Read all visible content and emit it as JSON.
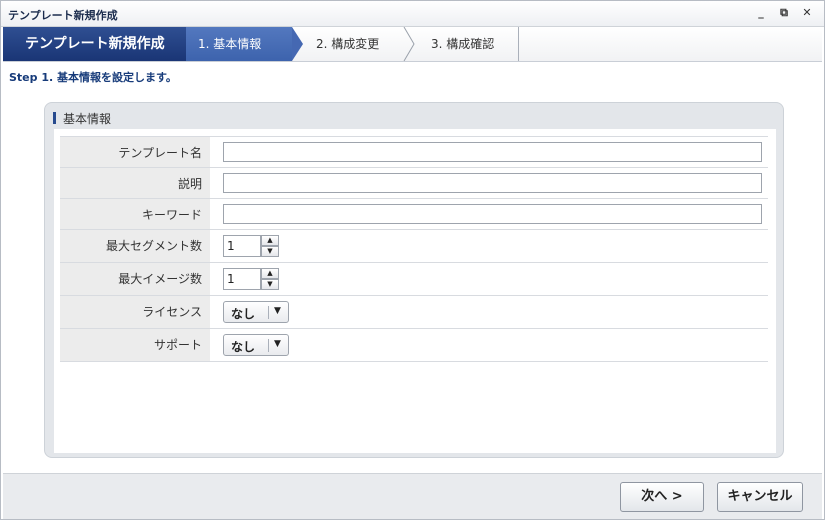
{
  "window": {
    "title": "テンプレート新規作成",
    "minimize": "_",
    "restore": "⧉",
    "close": "✕"
  },
  "wizard": {
    "title": "テンプレート新規作成",
    "steps": [
      {
        "label": "1. 基本情報",
        "active": true
      },
      {
        "label": "2. 構成変更",
        "active": false
      },
      {
        "label": "3. 構成確認",
        "active": false
      }
    ]
  },
  "step_description": "Step 1. 基本情報を設定します。",
  "panel": {
    "title": "基本情報",
    "fields": {
      "template_name": {
        "label": "テンプレート名",
        "value": ""
      },
      "description": {
        "label": "説明",
        "value": ""
      },
      "keyword": {
        "label": "キーワード",
        "value": ""
      },
      "max_segments": {
        "label": "最大セグメント数",
        "value": "1"
      },
      "max_images": {
        "label": "最大イメージ数",
        "value": "1"
      },
      "license": {
        "label": "ライセンス",
        "value": "なし"
      },
      "support": {
        "label": "サポート",
        "value": "なし"
      }
    }
  },
  "footer": {
    "next_label": "次へ >",
    "cancel_label": "キャンセル"
  },
  "colors": {
    "accent_dark": "#1a3575",
    "accent_step": "#4568b2"
  }
}
